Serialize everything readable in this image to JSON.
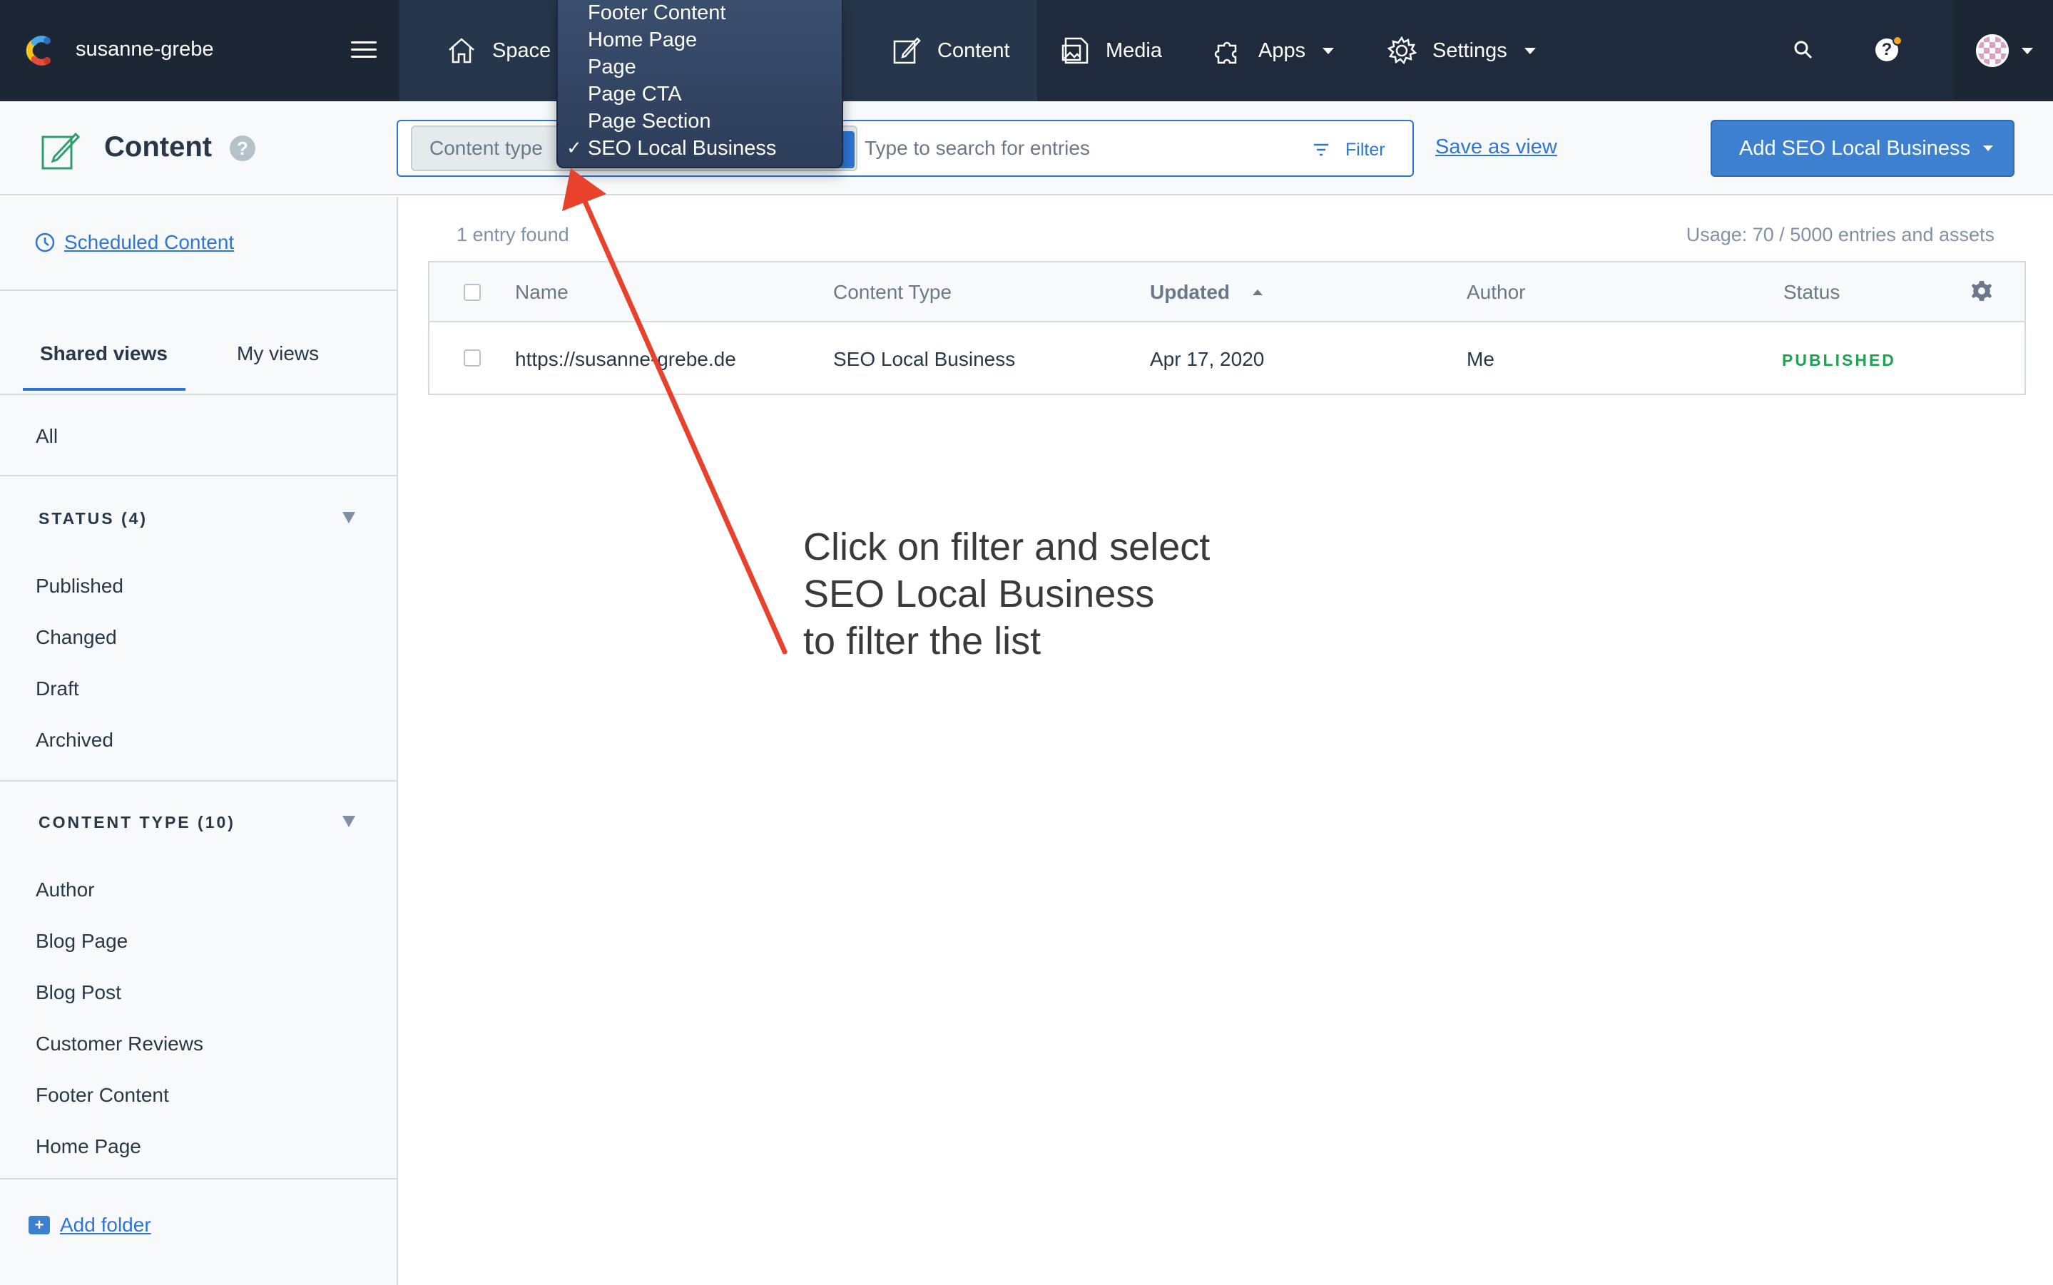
{
  "topnav": {
    "space_name": "susanne-grebe",
    "items": [
      {
        "label": "Space",
        "icon": "home-icon"
      },
      {
        "label": "Content",
        "icon": "edit-icon"
      },
      {
        "label": "Media",
        "icon": "media-icon"
      },
      {
        "label": "Apps",
        "icon": "puzzle-icon"
      },
      {
        "label": "Settings",
        "icon": "gear-icon"
      }
    ],
    "help_badge_color": "#f5a623"
  },
  "subheader": {
    "title": "Content",
    "content_type_label": "Content type",
    "search_placeholder": "Type to search for entries",
    "filter_label": "Filter",
    "save_view_label": "Save as view",
    "add_button_label": "Add SEO Local Business"
  },
  "dropdown": {
    "items": [
      "Footer Content",
      "Home Page",
      "Page",
      "Page CTA",
      "Page Section",
      "SEO Local Business"
    ],
    "selected": "SEO Local Business"
  },
  "sidebar": {
    "scheduled_label": "Scheduled Content",
    "tabs": [
      "Shared views",
      "My views"
    ],
    "all_label": "All",
    "status_section": "STATUS (4)",
    "status_items": [
      "Published",
      "Changed",
      "Draft",
      "Archived"
    ],
    "content_type_section": "CONTENT TYPE (10)",
    "content_type_items": [
      "Author",
      "Blog Page",
      "Blog Post",
      "Customer Reviews",
      "Footer Content",
      "Home Page"
    ],
    "add_folder_label": "Add folder"
  },
  "main": {
    "entry_count": "1 entry found",
    "usage": "Usage: 70 / 5000 entries and assets",
    "columns": [
      "Name",
      "Content Type",
      "Updated",
      "Author",
      "Status"
    ],
    "rows": [
      {
        "name": "https://susanne-grebe.de",
        "content_type": "SEO Local Business",
        "updated": "Apr 17, 2020",
        "author": "Me",
        "status": "PUBLISHED"
      }
    ]
  },
  "annotation": {
    "lines": [
      "Click on filter and select",
      "SEO Local Business",
      "to filter the list"
    ],
    "arrow_color": "#e8412c"
  },
  "colors": {
    "nav_bg": "#1f2b3d",
    "accent": "#2e75d4",
    "published": "#1ea44e"
  }
}
